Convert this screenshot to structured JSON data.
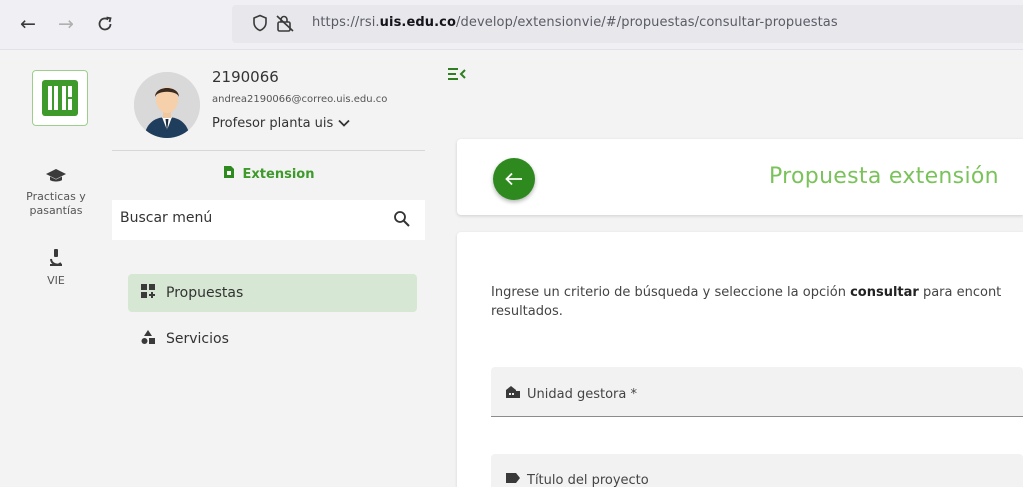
{
  "browser": {
    "url_prefix": "https://rsi.",
    "url_domain": "uis.edu.co",
    "url_path": "/develop/extensionvie/#/propuestas/consultar-propuestas"
  },
  "rail": {
    "items": [
      {
        "label_line1": "Practicas y",
        "label_line2": "pasantías",
        "icon": "graduation-cap-icon"
      },
      {
        "label_line1": "VIE",
        "icon": "microscope-icon"
      }
    ]
  },
  "user": {
    "id": "2190066",
    "email": "andrea2190066@correo.uis.edu.co",
    "role": "Profesor planta uis"
  },
  "sidebar": {
    "section_title": "Extension",
    "search_placeholder": "Buscar menú",
    "items": [
      {
        "label": "Propuestas",
        "icon": "dashboard-add-icon",
        "active": true
      },
      {
        "label": "Servicios",
        "icon": "shapes-icon",
        "active": false
      }
    ]
  },
  "header": {
    "title": "Propuesta extensión"
  },
  "content": {
    "instructions_pre": "Ingrese un criterio de búsqueda y seleccione la opción ",
    "instructions_bold": "consultar",
    "instructions_post": " para encont",
    "instructions_line2": "resultados.",
    "fields": [
      {
        "label": "Unidad gestora *",
        "icon": "building-icon"
      },
      {
        "label": "Título del proyecto",
        "icon": "label-tag-icon"
      }
    ]
  },
  "colors": {
    "brand_green": "#2e8a1f",
    "title_green": "#7ac25a",
    "active_bg": "#d6e8d3"
  }
}
